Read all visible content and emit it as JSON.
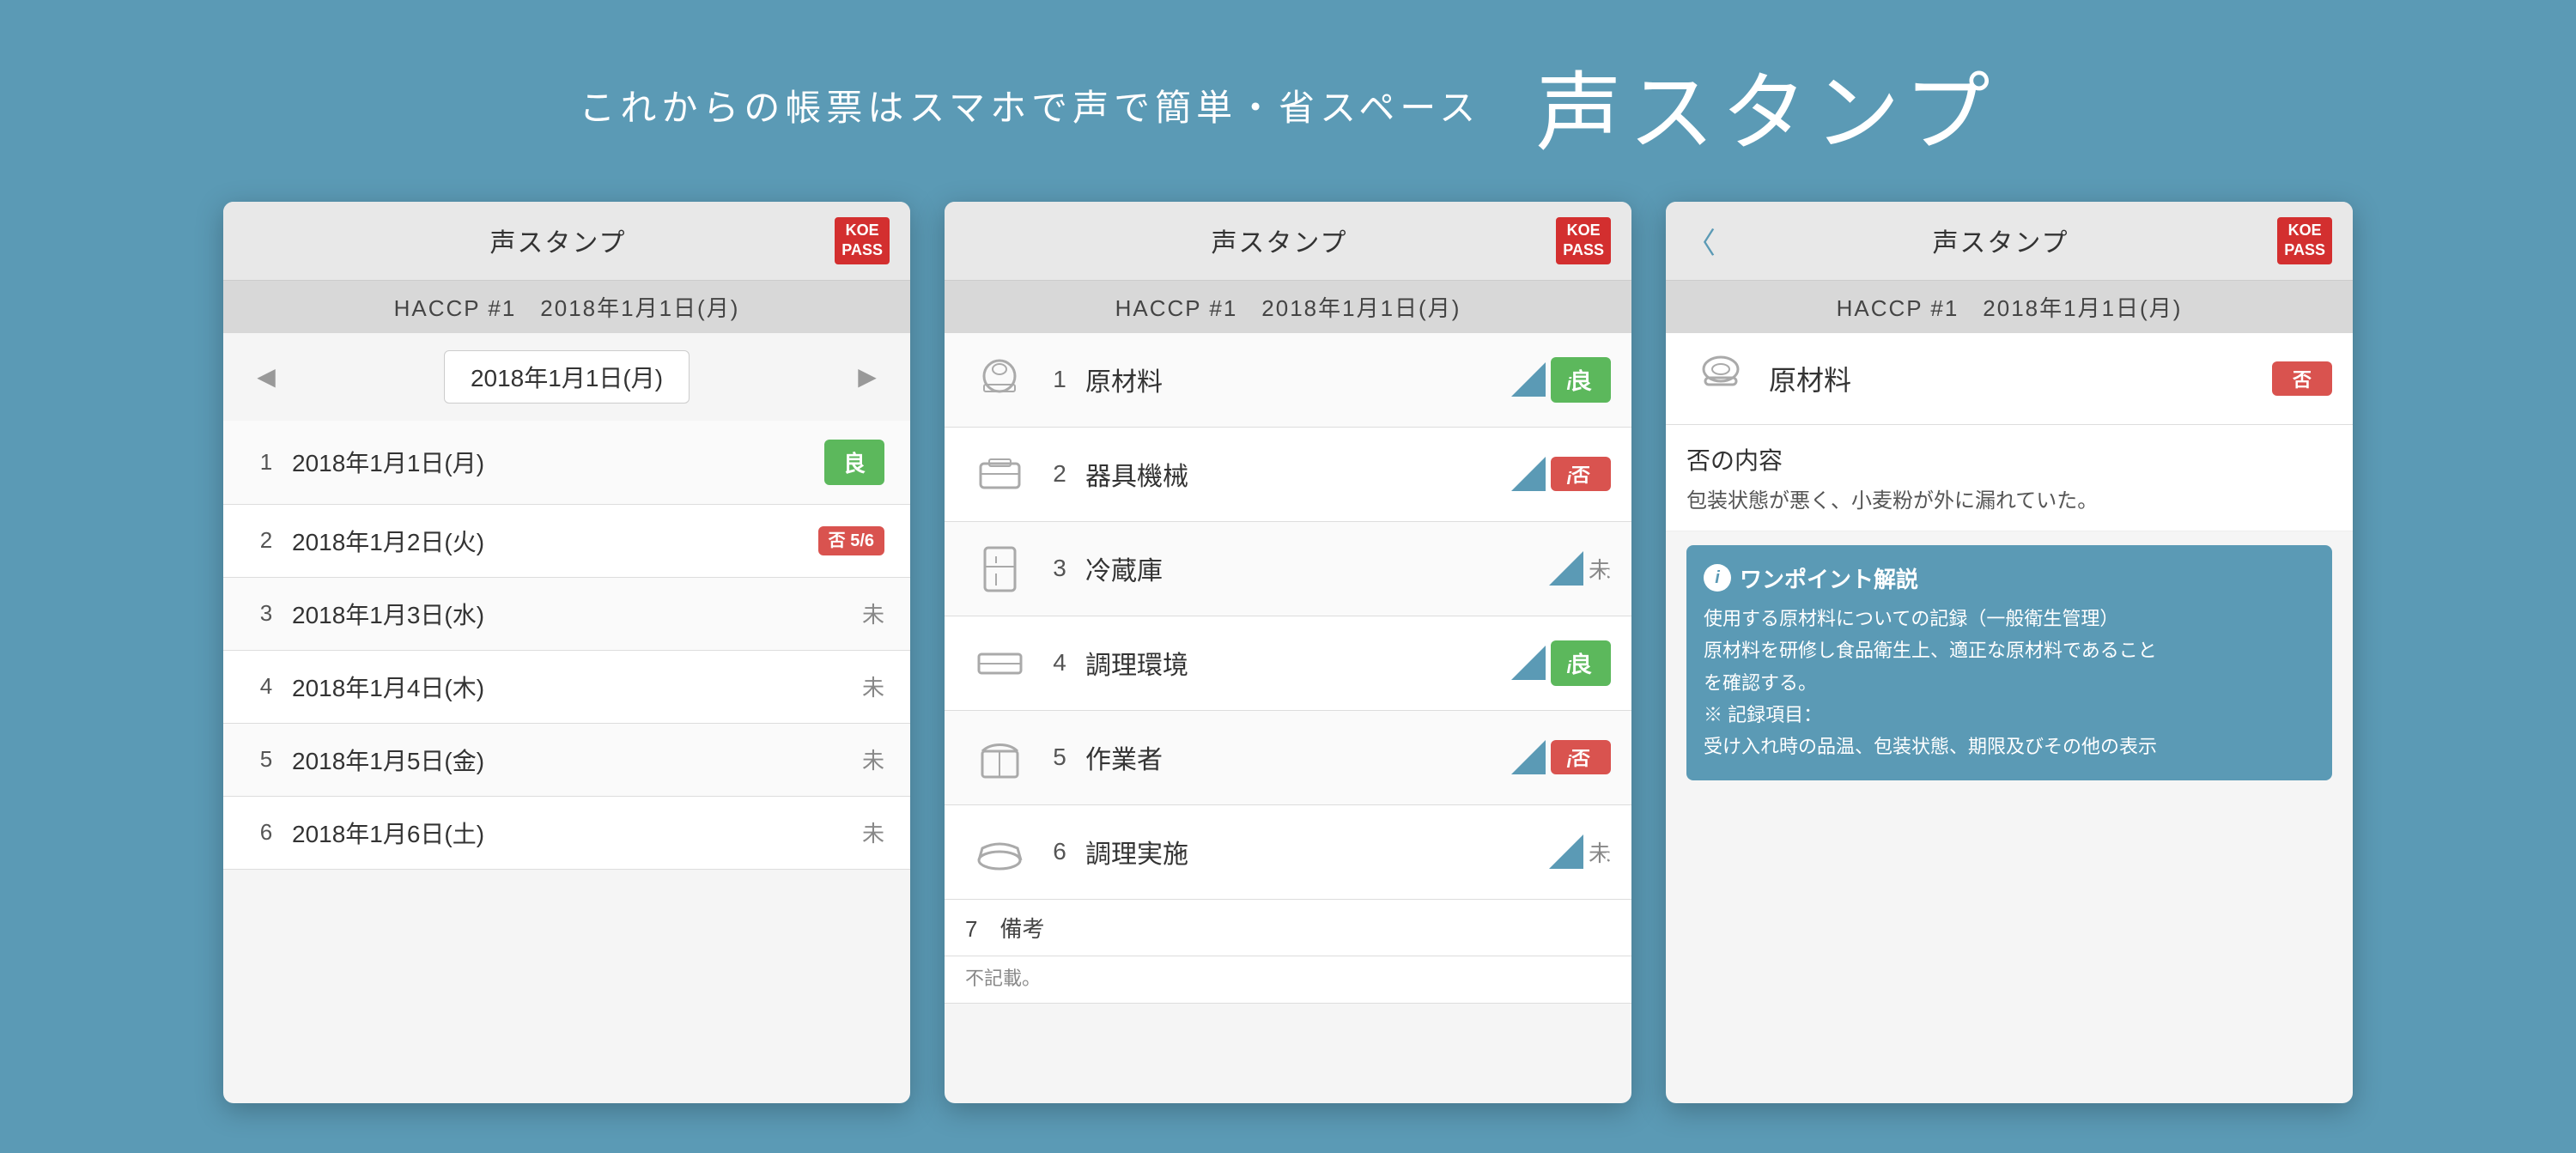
{
  "header": {
    "subtitle": "これからの帳票はスマホで声で簡単・省スペース",
    "title": "声スタンプ"
  },
  "phone1": {
    "app_name": "声スタンプ",
    "badge_line1": "KOE",
    "badge_line2": "PASS",
    "subheader": "HACCP #1　2018年1月1日(月)",
    "nav_date": "2018年1月1日(月)",
    "rows": [
      {
        "num": "1",
        "date": "2018年1月1日(月)",
        "status": "良",
        "status_type": "good"
      },
      {
        "num": "2",
        "date": "2018年1月2日(火)",
        "status": "否\n5/6",
        "status_type": "no"
      },
      {
        "num": "3",
        "date": "2018年1月3日(水)",
        "status": "未",
        "status_type": "pending"
      },
      {
        "num": "4",
        "date": "2018年1月4日(木)",
        "status": "未",
        "status_type": "pending"
      },
      {
        "num": "5",
        "date": "2018年1月5日(金)",
        "status": "未",
        "status_type": "pending"
      },
      {
        "num": "6",
        "date": "2018年1月6日(土)",
        "status": "未",
        "status_type": "pending"
      }
    ]
  },
  "phone2": {
    "app_name": "声スタンプ",
    "badge_line1": "KOE",
    "badge_line2": "PASS",
    "subheader": "HACCP #1　2018年1月1日(月)",
    "rows": [
      {
        "num": "1",
        "name": "原材料",
        "status": "良",
        "status_type": "good"
      },
      {
        "num": "2",
        "name": "器具機械",
        "status": "否",
        "status_type": "no"
      },
      {
        "num": "3",
        "name": "冷蔵庫",
        "status": "未",
        "status_type": "pending"
      },
      {
        "num": "4",
        "name": "調理環境",
        "status": "良",
        "status_type": "good"
      },
      {
        "num": "5",
        "name": "作業者",
        "status": "否",
        "status_type": "no"
      },
      {
        "num": "6",
        "name": "調理実施",
        "status": "未",
        "status_type": "pending"
      }
    ],
    "note_label": "7　備考",
    "note_value": "不記載。"
  },
  "phone3": {
    "app_name": "声スタンプ",
    "badge_line1": "KOE",
    "badge_line2": "PASS",
    "back_label": "〈",
    "subheader": "HACCP #1　2018年1月1日(月)",
    "item_name": "原材料",
    "item_status": "否",
    "item_status_type": "no",
    "no_reason_title": "否の内容",
    "no_reason_text": "包装状態が悪く、小麦粉が外に漏れていた。",
    "hint_title": "ワンポイント解説",
    "hint_lines": [
      "使用する原材料についての記録（一般衛生管理）",
      "原材料を研修し食品衛生上、適正な原材料であること",
      "を確認する。",
      "※ 記録項目：",
      "受け入れ時の品温、包装状態、期限及びその他の表示"
    ]
  }
}
